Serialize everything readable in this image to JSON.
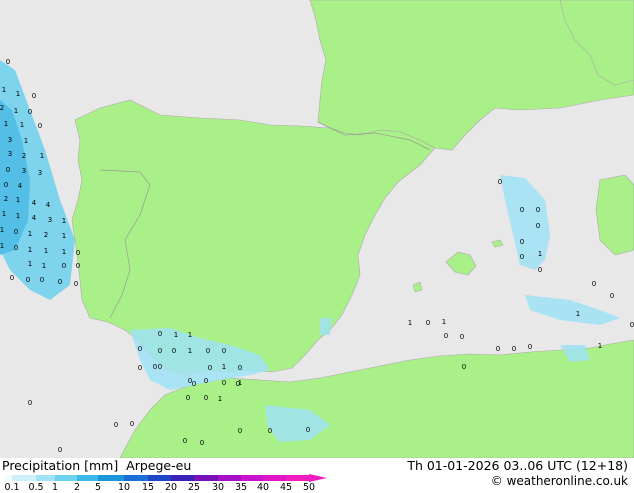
{
  "title": "Precipitation [mm]",
  "model": "Arpege-eu",
  "valid_time": "Th 01-01-2026 03..06 UTC (12+18)",
  "credit": "© weatheronline.co.uk",
  "legend_ticks": [
    "0.1",
    "0.5",
    "1",
    "2",
    "5",
    "10",
    "15",
    "20",
    "25",
    "30",
    "35",
    "40",
    "45",
    "50"
  ],
  "legend_colors": [
    "#f2fbfe",
    "#cdf0fa",
    "#9fe2f5",
    "#6cd0ef",
    "#3ab9e6",
    "#1a97da",
    "#1a6fd4",
    "#1f46c8",
    "#3a22b8",
    "#7a10b8",
    "#a410c4",
    "#c814cc",
    "#e016c8",
    "#f21cc0"
  ],
  "colors": {
    "land": "#aaf088",
    "sea": "#e8e8e8",
    "border": "#9a9a9a"
  },
  "map_values": [
    "0",
    "1",
    "1",
    "0",
    "2",
    "1",
    "0",
    "1",
    "1",
    "0",
    "3",
    "1",
    "3",
    "2",
    "1",
    "0",
    "3",
    "3",
    "0",
    "4",
    "2",
    "1",
    "4",
    "4",
    "1",
    "1",
    "4",
    "3",
    "1",
    "1",
    "0",
    "1",
    "2",
    "1",
    "1",
    "0",
    "1",
    "1",
    "1",
    "0",
    "1",
    "1",
    "0",
    "0",
    "0",
    "0",
    "0",
    "0",
    "0",
    "0",
    "0",
    "0",
    "0",
    "0",
    "1",
    "1",
    "0",
    "0",
    "0",
    "1",
    "0",
    "0",
    "0",
    "1",
    "0",
    "0",
    "0",
    "0",
    "1",
    "0",
    "0",
    "0",
    "0",
    "0",
    "0",
    "0",
    "0",
    "0",
    "1",
    "0",
    "0",
    "0",
    "0",
    "1",
    "1",
    "0",
    "1",
    "0",
    "0",
    "0",
    "0",
    "0",
    "0",
    "1",
    "0",
    "0",
    "0",
    "0",
    "0",
    "0",
    "0",
    "1",
    "0",
    "0",
    "0",
    "0",
    "1",
    "0",
    "0"
  ]
}
